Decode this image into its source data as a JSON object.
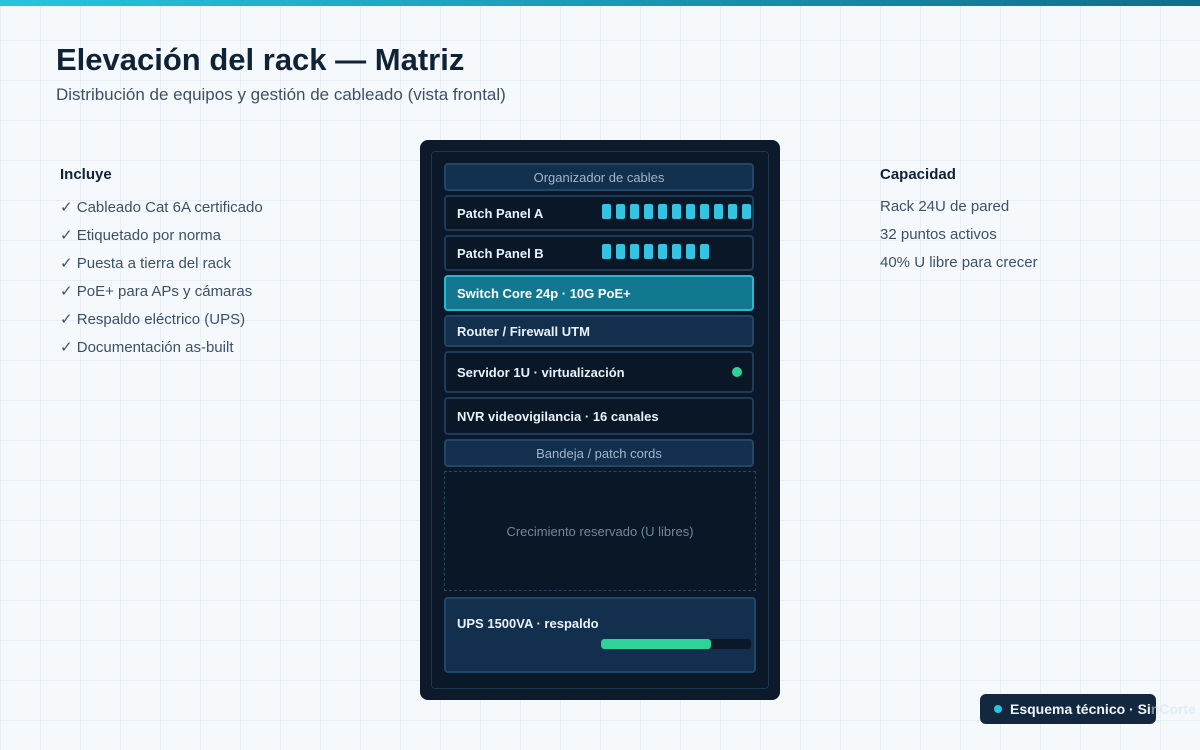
{
  "header": {
    "title": "Elevación del rack — Matriz",
    "subtitle": "Distribución de equipos y gestión de cableado (vista frontal)"
  },
  "includes": {
    "heading": "Incluye",
    "items": [
      "✓ Cableado Cat 6A certificado",
      "✓ Etiquetado por norma",
      "✓ Puesta a tierra del rack",
      "✓ PoE+ para APs y cámaras",
      "✓ Respaldo eléctrico (UPS)",
      "✓ Documentación as-built"
    ]
  },
  "capacity": {
    "heading": "Capacidad",
    "items": [
      "Rack 24U de pared",
      "32 puntos activos",
      "40% U libre para crecer"
    ]
  },
  "rack": {
    "organizer_top": "Organizador de cables",
    "patch_a": {
      "label": "Patch Panel A",
      "port_count": 11
    },
    "patch_b": {
      "label": "Patch Panel B",
      "port_count": 8
    },
    "switch": "Switch Core 24p · 10G PoE+",
    "router": "Router / Firewall UTM",
    "server": "Servidor 1U · virtualización",
    "nvr": "NVR videovigilancia · 16 canales",
    "tray": "Bandeja / patch cords",
    "reserved": "Crecimiento reservado (U libres)",
    "ups": {
      "label": "UPS 1500VA · respaldo",
      "charge_fraction": 0.733
    }
  },
  "badge": {
    "text": "Esquema técnico · Si",
    "faded": "nCorte"
  },
  "colors": {
    "accent": "#27c4e0",
    "rack_bg": "#0c1a2b",
    "active_unit": "#11788f",
    "status_green": "#2fd39a"
  }
}
